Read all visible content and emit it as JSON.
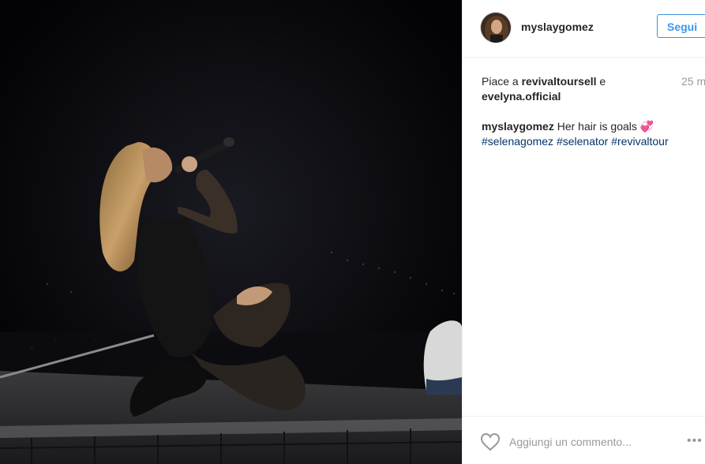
{
  "post": {
    "username": "myslaygomez",
    "follow_label": "Segui",
    "likes": {
      "prefix": "Piace a",
      "user1": "revivaltoursell",
      "conjunction": "e",
      "user2": "evelyna.official"
    },
    "time": "25 m",
    "caption": {
      "username": "myslaygomez",
      "text": "Her hair is goals",
      "emoji": "💞",
      "hashtags": [
        "#selenagomez",
        "#selenator",
        "#revivaltour"
      ]
    },
    "comment_placeholder": "Aggiungi un commento...",
    "more_label": "•••",
    "icons": {
      "like": "heart-outline-icon",
      "more": "more-options-icon"
    }
  },
  "colors": {
    "follow_blue": "#3897f0",
    "hashtag": "#003569",
    "muted": "#999999",
    "text": "#262626"
  }
}
